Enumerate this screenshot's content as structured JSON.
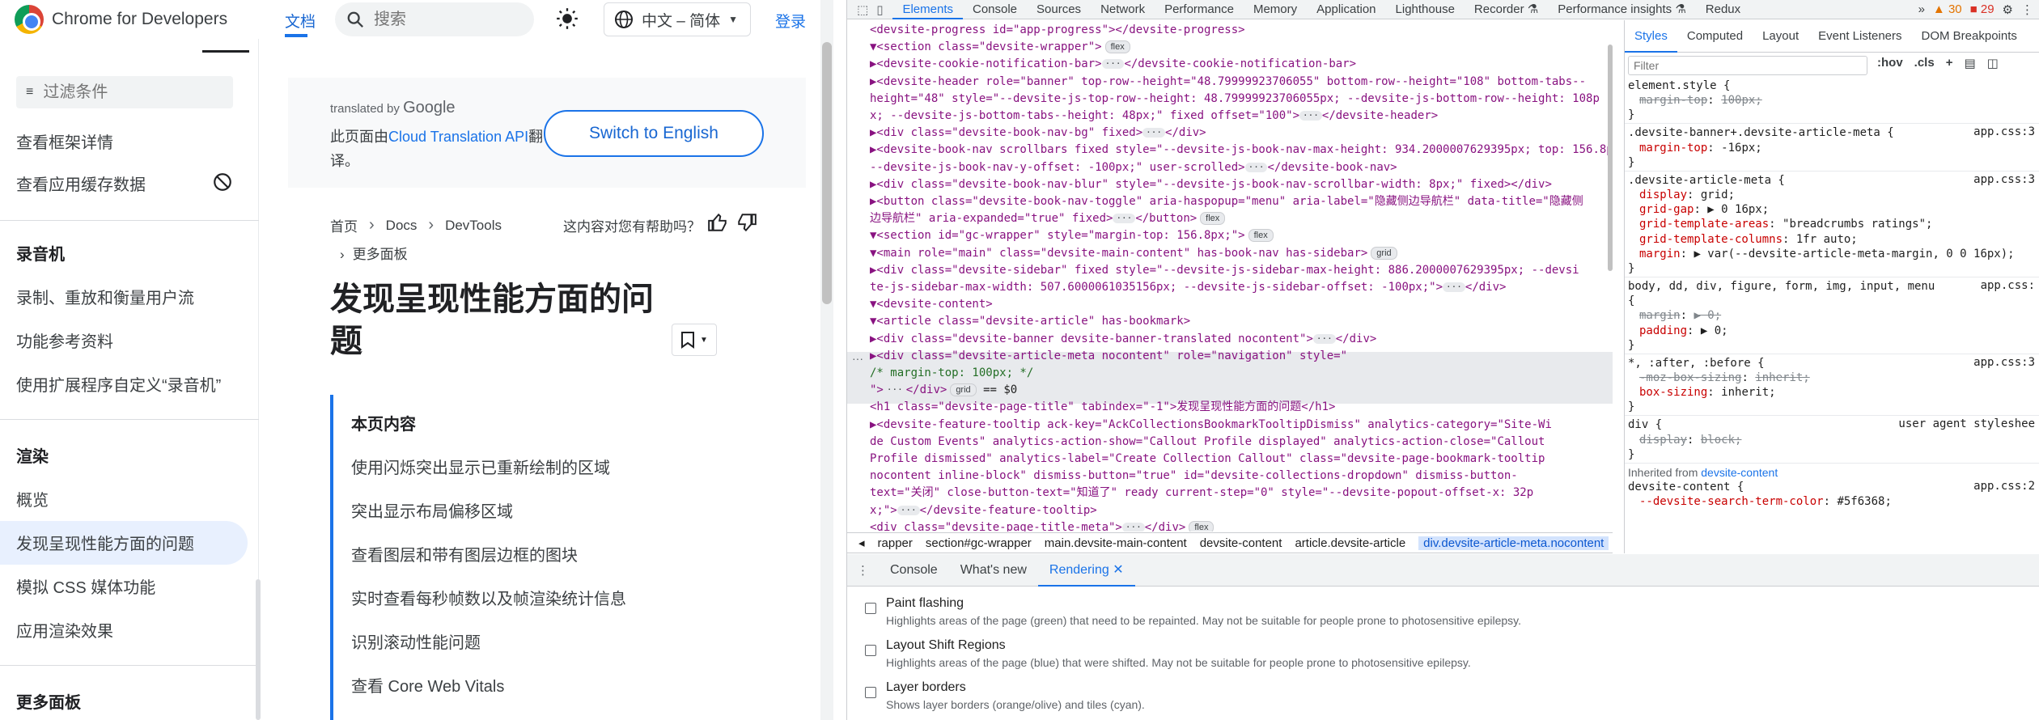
{
  "site": {
    "title": "Chrome for Developers",
    "nav_doc": "文档",
    "search_placeholder": "搜索",
    "language": "中文 – 简体",
    "login": "登录"
  },
  "sidebar": {
    "filter_placeholder": "过滤条件",
    "items": [
      "查看框架详情",
      "查看应用缓存数据"
    ],
    "sections": [
      {
        "heading": "录音机",
        "items": [
          "录制、重放和衡量用户流",
          "功能参考资料",
          "使用扩展程序自定义“录音机”"
        ]
      },
      {
        "heading": "渲染",
        "items": [
          "概览",
          "发现呈现性能方面的问题",
          "模拟 CSS 媒体功能",
          "应用渲染效果"
        ]
      },
      {
        "heading": "更多面板"
      }
    ]
  },
  "banner": {
    "translated_by": "translated by",
    "google": "Google",
    "text_pre": "此页面由",
    "link": "Cloud Translation API",
    "text_post": "翻译。",
    "switch_button": "Switch to English"
  },
  "breadcrumb": {
    "items": [
      "首页",
      "Docs",
      "DevTools"
    ],
    "more": "更多面板",
    "helpful": "这内容对您有帮助吗？"
  },
  "article": {
    "title": "发现呈现性能方面的问题",
    "toc_title": "本页内容",
    "toc": [
      "使用闪烁突出显示已重新绘制的区域",
      "突出显示布局偏移区域",
      "查看图层和带有图层边框的图块",
      "实时查看每秒帧数以及帧渲染统计信息",
      "识别滚动性能问题",
      "查看 Core Web Vitals"
    ]
  },
  "devtools": {
    "tabs": [
      "Elements",
      "Console",
      "Sources",
      "Network",
      "Performance",
      "Memory",
      "Application",
      "Lighthouse",
      "Recorder",
      "Performance insights"
    ],
    "warnings": "30",
    "errors": "29",
    "elements": [
      {
        "t": "<devsite-progress id=\"app-progress\"></devsite-progress>"
      },
      {
        "t": "▼<section class=\"devsite-wrapper\">",
        "pill": "flex"
      },
      {
        "t": "  ▶<devsite-cookie-notification-bar>",
        "dots": true,
        "t2": "</devsite-cookie-notification-bar>"
      },
      {
        "t": "  ▶<devsite-header role=\"banner\" top-row--height=\"48.79999923706055\" bottom-row--height=\"108\" bottom-tabs--"
      },
      {
        "t": "   height=\"48\" style=\"--devsite-js-top-row--height: 48.79999923706055px; --devsite-js-bottom-row--height: 108p"
      },
      {
        "t": "   x; --devsite-js-bottom-tabs--height: 48px;\" fixed offset=\"100\">",
        "dots": true,
        "t2": "</devsite-header>"
      },
      {
        "t": "  ▶<div class=\"devsite-book-nav-bg\" fixed>",
        "dots": true,
        "t2": "</div>"
      },
      {
        "t": "  ▶<devsite-book-nav scrollbars fixed style=\"--devsite-js-book-nav-max-height: 934.2000007629395px; top: 156.8px;"
      },
      {
        "t": "   --devsite-js-book-nav-y-offset: -100px;\" user-scrolled>",
        "dots": true,
        "t2": "</devsite-book-nav>"
      },
      {
        "t": "  ▶<div class=\"devsite-book-nav-blur\" style=\"--devsite-js-book-nav-scrollbar-width: 8px;\" fixed></div>"
      },
      {
        "t": "  ▶<button class=\"devsite-book-nav-toggle\" aria-haspopup=\"menu\" aria-label=\"隐藏侧边导航栏\" data-title=\"隐藏侧"
      },
      {
        "t": "   边导航栏\" aria-expanded=\"true\" fixed>",
        "dots": true,
        "t2": "</button>",
        "pill": "flex"
      },
      {
        "t": "  ▼<section id=\"gc-wrapper\" style=\"margin-top: 156.8px;\">",
        "pill": "flex"
      },
      {
        "t": "    ▼<main role=\"main\" class=\"devsite-main-content\" has-book-nav has-sidebar>",
        "pill": "grid"
      },
      {
        "t": "      ▶<div class=\"devsite-sidebar\" fixed style=\"--devsite-js-sidebar-max-height: 886.2000007629395px; --devsi"
      },
      {
        "t": "       te-js-sidebar-max-width: 507.6000061035156px; --devsite-js-sidebar-offset: -100px;\">",
        "dots": true,
        "t2": "</div>"
      },
      {
        "t": "      ▼<devsite-content>"
      },
      {
        "t": "        ▼<article class=\"devsite-article\" has-bookmark>"
      },
      {
        "t": "          ▶<div class=\"devsite-banner devsite-banner-translated nocontent\">",
        "dots": true,
        "t2": "</div>"
      },
      {
        "t": "          ▶<div class=\"devsite-article-meta nocontent\" role=\"navigation\" style=\""
      },
      {
        "t": "               /* margin-top: 100px; */",
        "cm": true
      },
      {
        "t": "          \">",
        "dots": true,
        "t2": "</div>",
        "pill": "grid",
        "t3": " == $0"
      },
      {
        "t": "          <h1 class=\"devsite-page-title\" tabindex=\"-1\">发现呈现性能方面的问题</h1>"
      },
      {
        "t": "          ▶<devsite-feature-tooltip ack-key=\"AckCollectionsBookmarkTooltipDismiss\" analytics-category=\"Site-Wi"
      },
      {
        "t": "           de Custom Events\" analytics-action-show=\"Callout Profile displayed\" analytics-action-close=\"Callout"
      },
      {
        "t": "           Profile dismissed\" analytics-label=\"Create Collection Callout\" class=\"devsite-page-bookmark-tooltip"
      },
      {
        "t": "           nocontent inline-block\" dismiss-button=\"true\" id=\"devsite-collections-dropdown\" dismiss-button-"
      },
      {
        "t": "           text=\"关闭\" close-button-text=\"知道了\" ready current-step=\"0\" style=\"--devsite-popout-offset-x: 32p"
      },
      {
        "t": "           x;\">",
        "dots": true,
        "t2": "</devsite-feature-tooltip>"
      },
      {
        "t": "          <div class=\"devsite-page-title-meta\">",
        "dots": true,
        "t2": "</div>",
        "pill": "flex"
      }
    ],
    "crumbs": [
      "rapper",
      "section#gc-wrapper",
      "main.devsite-main-content",
      "devsite-content",
      "article.devsite-article",
      "div.devsite-article-meta.nocontent"
    ],
    "styles_tabs": [
      "Styles",
      "Computed",
      "Layout",
      "Event Listeners",
      "DOM Breakpoints"
    ],
    "styles_filter": "Filter",
    "styles_tools": [
      ":hov",
      ".cls"
    ],
    "styles": [
      {
        "sel": "element.style {"
      },
      {
        "prop": "margin-top",
        "val": "100px;",
        "strike": true
      },
      {
        "sel": "}"
      },
      {
        "sel": ".devsite-banner+.devsite-article-meta {",
        "link": "app.css:3"
      },
      {
        "prop": "margin-top",
        "val": "-16px;"
      },
      {
        "sel": "}"
      },
      {
        "sel": ".devsite-article-meta {",
        "link": "app.css:3"
      },
      {
        "prop": "display",
        "val": "grid;"
      },
      {
        "prop": "grid-gap",
        "val": "▶ 0 16px;"
      },
      {
        "prop": "grid-template-areas",
        "val": "\"breadcrumbs ratings\";"
      },
      {
        "prop": "grid-template-columns",
        "val": "1fr auto;"
      },
      {
        "prop": "margin",
        "val": "▶ var(--devsite-article-meta-margin, 0 0 16px);"
      },
      {
        "sel": "}"
      },
      {
        "sel": "body, dd, div, figure, form, img, input, menu",
        "link": "app.css:"
      },
      {
        "sel": "{"
      },
      {
        "prop": "margin",
        "val": "▶ 0;",
        "strike": true
      },
      {
        "prop": "padding",
        "val": "▶ 0;"
      },
      {
        "sel": "}"
      },
      {
        "sel": "*, :after, :before {",
        "link": "app.css:3"
      },
      {
        "prop": "-moz-box-sizing",
        "val": "inherit;",
        "strike": true
      },
      {
        "prop": "box-sizing",
        "val": "inherit;"
      },
      {
        "sel": "}"
      },
      {
        "sel": "div {",
        "link": "user agent styleshee"
      },
      {
        "prop": "display",
        "val": "block;",
        "strike": true
      },
      {
        "sel": "}"
      },
      {
        "inherited": "Inherited from",
        "from": "devsite-content"
      },
      {
        "sel": "devsite-content {",
        "link": "app.css:2"
      },
      {
        "prop": "--devsite-search-term-color",
        "val": "#5f6368;"
      }
    ],
    "drawer_tabs": [
      "Console",
      "What's new",
      "Rendering"
    ],
    "rendering": [
      {
        "title": "Paint flashing",
        "desc": "Highlights areas of the page (green) that need to be repainted. May not be suitable for people prone to photosensitive epilepsy."
      },
      {
        "title": "Layout Shift Regions",
        "desc": "Highlights areas of the page (blue) that were shifted. May not be suitable for people prone to photosensitive epilepsy."
      },
      {
        "title": "Layer borders",
        "desc": "Shows layer borders (orange/olive) and tiles (cyan)."
      }
    ],
    "redux": "Redux"
  }
}
